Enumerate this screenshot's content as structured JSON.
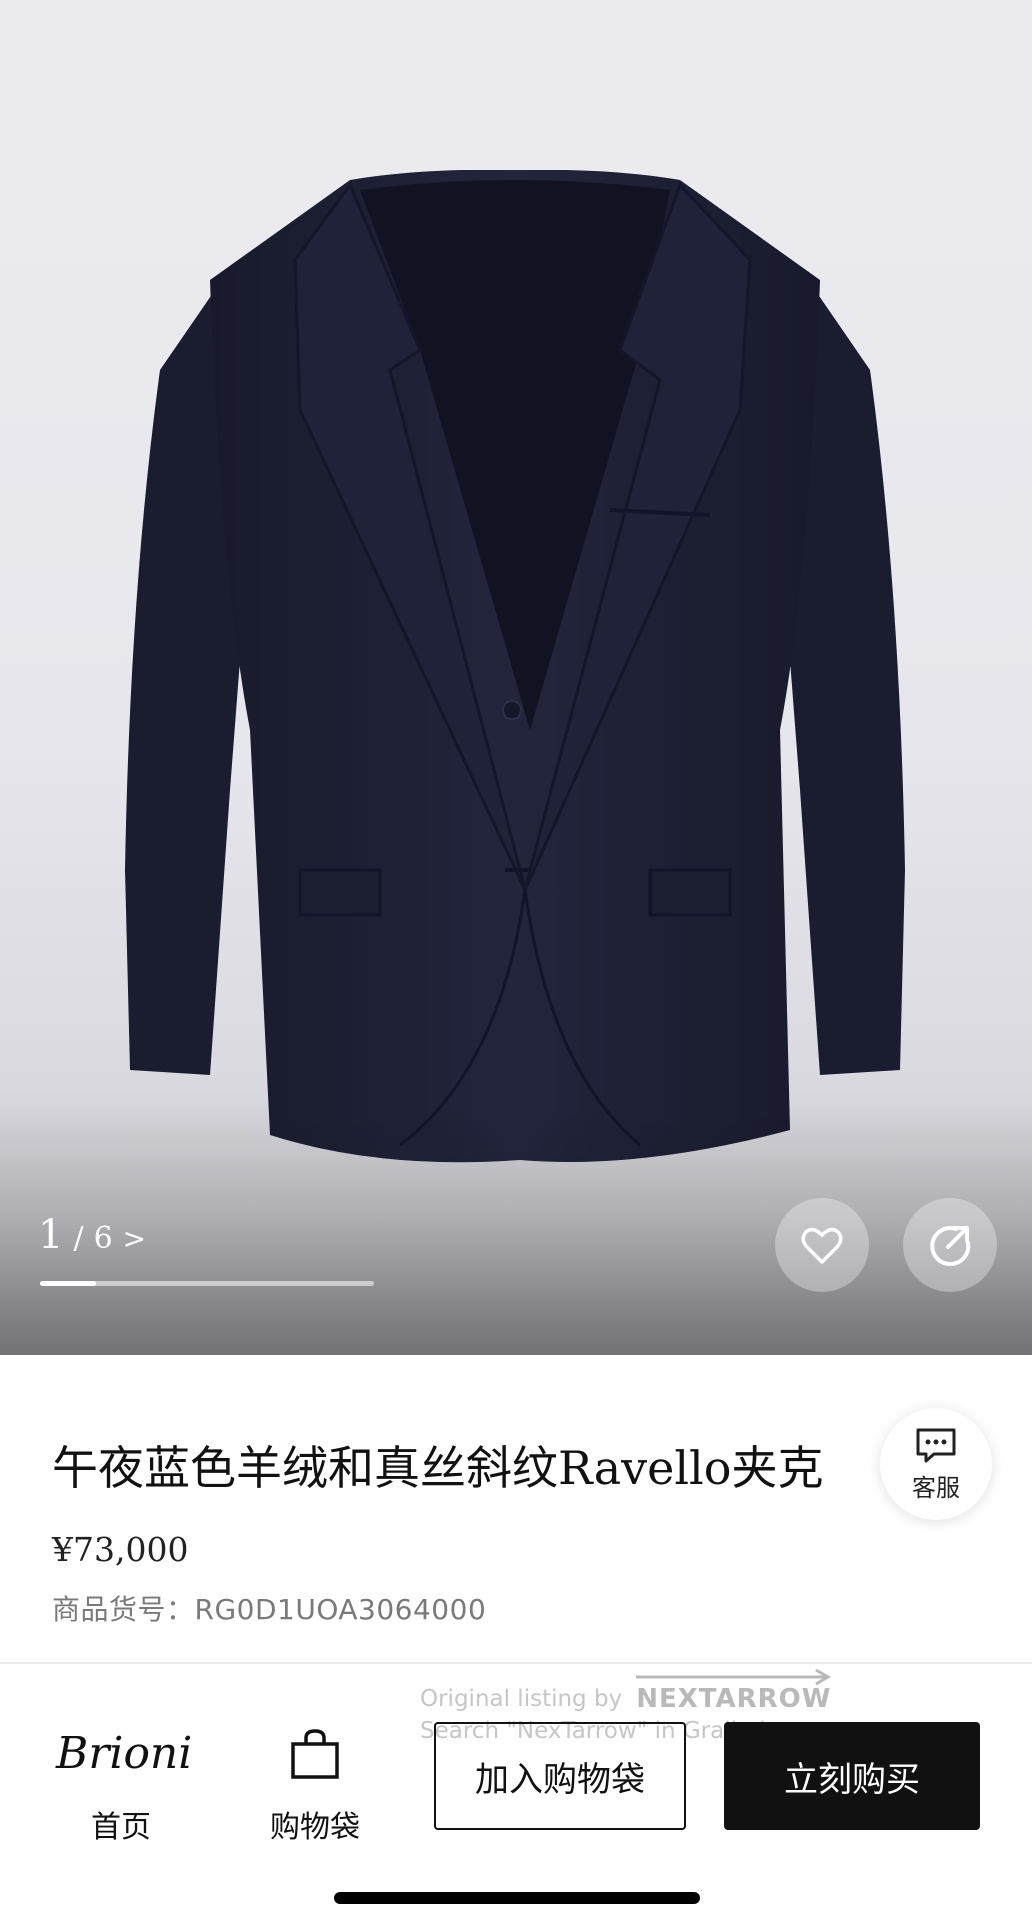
{
  "gallery": {
    "current": "1",
    "separator": "/",
    "total": "6",
    "next_arrow": ">",
    "progress_fraction": 0.167
  },
  "product": {
    "title": "午夜蓝色羊绒和真丝斜纹Ravello夹克",
    "price": "¥73,000",
    "sku_label": "商品货号：",
    "sku_value": "RG0D1UOA3064000"
  },
  "customer_service": {
    "label": "客服",
    "icon": "chat-bubble-icon"
  },
  "actions": {
    "favorite_icon": "heart-icon",
    "share_icon": "share-icon"
  },
  "watermark": {
    "line1": "Original listing by",
    "brand": "NEXTARROW",
    "line2": "Search \"NexTarrow\" in Grailed app."
  },
  "bottom_bar": {
    "logo_text": "Brioni",
    "home_label": "首页",
    "bag_label": "购物袋",
    "add_to_bag": "加入购物袋",
    "buy_now": "立刻购买"
  },
  "colors": {
    "jacket_navy": "#1d2035",
    "accent_black": "#111111",
    "hero_bg": "#e8e8ed"
  }
}
